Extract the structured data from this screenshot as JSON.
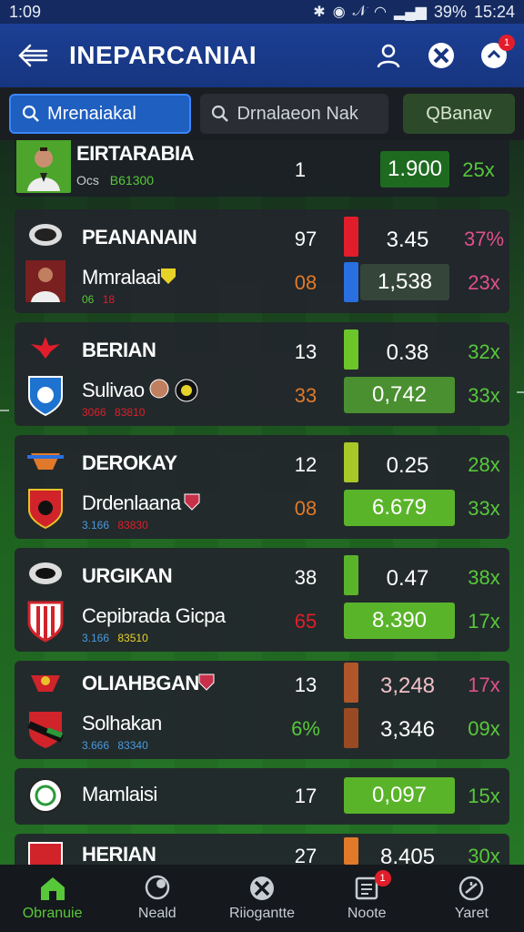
{
  "status_bar": {
    "time_left": "1:09",
    "battery": "39%",
    "time_right": "15:24"
  },
  "header": {
    "title": "INEPARCANIAI",
    "notification_count": "1",
    "icons": [
      "back-arrow-icon",
      "user-icon",
      "ball-icon",
      "notification-icon"
    ]
  },
  "search": {
    "tab1": "Mrenaiakal",
    "tab2": "Drnalaeon Nak",
    "tab3": "QBanav"
  },
  "colors": {
    "accent_blue": "#1f5fc0",
    "green": "#57c83a",
    "red": "#e21d2b",
    "orange": "#e07a2a"
  },
  "rows": [
    {
      "team": "EIRTARABIA",
      "sub": "Ocs",
      "sub2": "B61300",
      "num": "1",
      "value": "1.900",
      "pct": "25x"
    },
    {
      "team": "PEANANAIN",
      "num": "97",
      "value": "3.45",
      "pct": "37%"
    },
    {
      "team": "Mmralaai",
      "sub": "06",
      "sub2": "18",
      "num": "08",
      "value": "1,538",
      "pct": "23x"
    },
    {
      "team": "BERIAN",
      "num": "13",
      "value": "0.38",
      "pct": "32x"
    },
    {
      "team": "Sulivao",
      "sub": "3066",
      "sub2": "83810",
      "num": "33",
      "value": "0,742",
      "pct": "33x"
    },
    {
      "team": "DEROKAY",
      "num": "12",
      "value": "0.25",
      "pct": "28x"
    },
    {
      "team": "Drdenlaana",
      "sub": "3.166",
      "sub2": "83830",
      "num": "08",
      "value": "6.679",
      "pct": "33x"
    },
    {
      "team": "URGIKAN",
      "num": "38",
      "value": "0.47",
      "pct": "38x"
    },
    {
      "team": "Cepibrada Gicpa",
      "sub": "3.166",
      "sub2": "83510",
      "num": "65",
      "value": "8.390",
      "pct": "17x"
    },
    {
      "team": "OLIAHBGAN",
      "num": "13",
      "value": "3,248",
      "pct": "17x"
    },
    {
      "team": "Solhakan",
      "sub": "3.666",
      "sub2": "83340",
      "num": "6%",
      "value": "3,346",
      "pct": "09x"
    },
    {
      "team": "Mamlaisi",
      "num": "17",
      "value": "0,097",
      "pct": "15x"
    },
    {
      "team": "HERIAN",
      "num": "27",
      "value": "8.405",
      "pct": "30x"
    }
  ],
  "nav": {
    "item1": "Obranuie",
    "item2": "Neald",
    "item3": "Riiogantte",
    "item4": "Noote",
    "item4_badge": "1",
    "item5": "Yaret"
  }
}
